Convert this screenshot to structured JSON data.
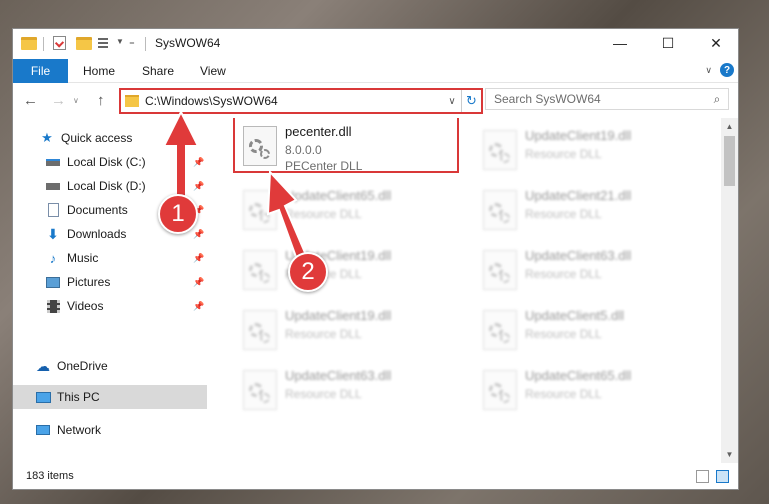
{
  "window": {
    "title": "SysWOW64",
    "minimize": "—",
    "maximize": "☐",
    "close": "✕"
  },
  "ribbon": {
    "file": "File",
    "tabs": [
      "Home",
      "Share",
      "View"
    ]
  },
  "address": {
    "path": "C:\\Windows\\SysWOW64",
    "search_placeholder": "Search SysWOW64"
  },
  "sidebar": {
    "items": [
      {
        "label": "Quick access",
        "icon": "star-icon"
      },
      {
        "label": "Local Disk (C:)",
        "icon": "drive-icon",
        "pinned": true
      },
      {
        "label": "Local Disk (D:)",
        "icon": "drive-icon",
        "pinned": true
      },
      {
        "label": "Documents",
        "icon": "documents-icon",
        "pinned": true
      },
      {
        "label": "Downloads",
        "icon": "downloads-icon",
        "pinned": true
      },
      {
        "label": "Music",
        "icon": "music-icon",
        "pinned": true
      },
      {
        "label": "Pictures",
        "icon": "pictures-icon",
        "pinned": true
      },
      {
        "label": "Videos",
        "icon": "videos-icon",
        "pinned": true
      },
      {
        "label": "OneDrive",
        "icon": "cloud-icon"
      },
      {
        "label": "This PC",
        "icon": "computer-icon",
        "selected": true
      },
      {
        "label": "Network",
        "icon": "network-icon"
      }
    ]
  },
  "files": {
    "left": [
      {
        "name": "pecenter.dll",
        "line1": "8.0.0.0",
        "line2": "PECenter DLL"
      },
      {
        "name": "UpdateClient65.dll",
        "line1": "Resource DLL"
      },
      {
        "name": "UpdateClient19.dll",
        "line1": "Resource DLL"
      },
      {
        "name": "UpdateClient19.dll",
        "line1": "Resource DLL"
      },
      {
        "name": "UpdateClient63.dll",
        "line1": "Resource DLL"
      }
    ],
    "right": [
      {
        "name": "UpdateClient19.dll",
        "line1": "Resource DLL"
      },
      {
        "name": "UpdateClient21.dll",
        "line1": "Resource DLL"
      },
      {
        "name": "UpdateClient63.dll",
        "line1": "Resource DLL"
      },
      {
        "name": "UpdateClient5.dll",
        "line1": "Resource DLL"
      },
      {
        "name": "UpdateClient65.dll",
        "line1": "Resource DLL"
      }
    ]
  },
  "status": {
    "count": "183 items"
  },
  "annotations": [
    "1",
    "2"
  ],
  "colors": {
    "accent": "#1979ca",
    "highlight": "#d93838"
  }
}
